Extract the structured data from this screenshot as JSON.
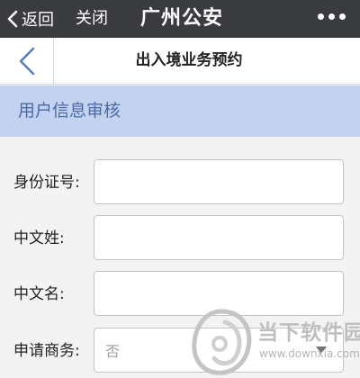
{
  "topbar": {
    "back_label": "返回",
    "close_label": "关闭",
    "title": "广州公安",
    "back_icon": "chevron-left-icon",
    "more_icon": "more-dots-icon"
  },
  "navbar": {
    "title": "出入境业务预约",
    "back_icon": "chevron-left-icon"
  },
  "section": {
    "title": "用户信息审核"
  },
  "form": {
    "fields": [
      {
        "label": "身份证号:",
        "value": ""
      },
      {
        "label": "中文姓:",
        "value": ""
      },
      {
        "label": "中文名:",
        "value": ""
      },
      {
        "label": "申请商务:",
        "value": "否"
      }
    ]
  },
  "watermark": {
    "title": "当下软件园",
    "url": "www.downxia.com"
  },
  "colors": {
    "topbar_bg": "#3a3b3f",
    "section_bg": "#c3d2ef",
    "section_text": "#4a6aa8",
    "nav_icon": "#5b7bbf"
  }
}
